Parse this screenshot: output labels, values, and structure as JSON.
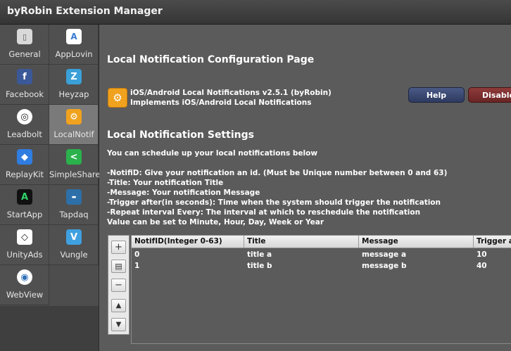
{
  "window": {
    "title": "byRobin Extension Manager"
  },
  "sidebar": {
    "items": [
      {
        "label": "General",
        "icon": "general-icon"
      },
      {
        "label": "AppLovin",
        "icon": "applovin-icon"
      },
      {
        "label": "Facebook",
        "icon": "facebook-icon"
      },
      {
        "label": "Heyzap",
        "icon": "heyzap-icon"
      },
      {
        "label": "Leadbolt",
        "icon": "leadbolt-icon"
      },
      {
        "label": "LocalNotif",
        "icon": "localnotif-icon",
        "selected": true
      },
      {
        "label": "ReplayKit",
        "icon": "replaykit-icon"
      },
      {
        "label": "SimpleShare",
        "icon": "simpleshare-icon"
      },
      {
        "label": "StartApp",
        "icon": "startapp-icon"
      },
      {
        "label": "Tapdaq",
        "icon": "tapdaq-icon"
      },
      {
        "label": "UnityAds",
        "icon": "unityads-icon"
      },
      {
        "label": "Vungle",
        "icon": "vungle-icon"
      },
      {
        "label": "WebView",
        "icon": "webview-icon"
      }
    ]
  },
  "main": {
    "title": "Local Notification Configuration Page",
    "plugin": {
      "name": "iOS/Android Local Notifications v2.5.1 (byRobin)",
      "subtitle": "Implements iOS/Android Local Notifications",
      "help_label": "Help",
      "disable_label": "Disable"
    },
    "settings_title": "Local Notification Settings",
    "description": [
      "You can schedule up your local notifications below",
      "",
      "-NotifiD: Give your notification an id. (Must be Unique number between 0 and 63)",
      "-Title: Your notification Title",
      "-Message: Your notification Message",
      "-Trigger after(in seconds): Time when the system should trigger the notification",
      "-Repeat interval Every: The interval at which to reschedule the notification",
      "Value can be set to Minute, Hour, Day, Week or Year"
    ],
    "table": {
      "columns": [
        "NotifID(Integer 0-63)",
        "Title",
        "Message",
        "Trigger a"
      ],
      "rows": [
        [
          "0",
          "title a",
          "message a",
          "10"
        ],
        [
          "1",
          "title b",
          "message b",
          "40"
        ]
      ]
    }
  },
  "colors": {
    "help_button": "#3a4770",
    "disable_button": "#7a2e2e",
    "selected_item": "#7a7a7a",
    "plugin_icon": "#f0a21e"
  }
}
